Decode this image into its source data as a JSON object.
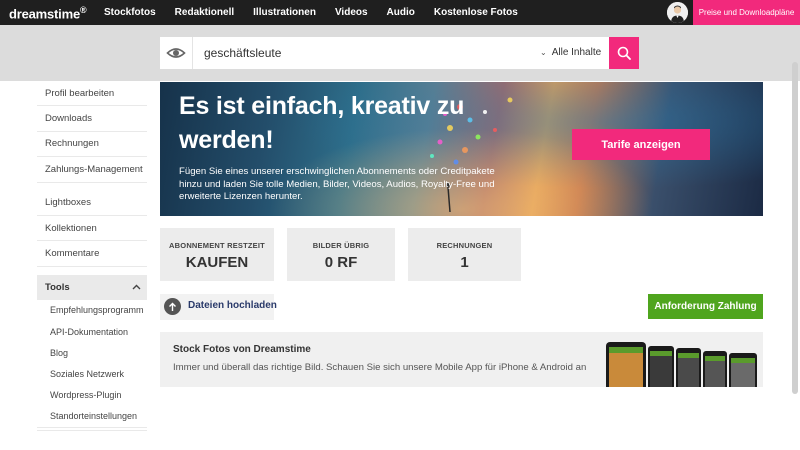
{
  "brand": {
    "logo_text": "dreamstime",
    "logo_mark": "®"
  },
  "nav": {
    "links": [
      "Stockfotos",
      "Redaktionell",
      "Illustrationen",
      "Videos",
      "Audio",
      "Kostenlose Fotos"
    ],
    "pricing_label": "Preise und Downloadpläne"
  },
  "search": {
    "value": "geschäftsleute",
    "filter_label": "Alle Inhalte",
    "filter_icon": "chevron-down-icon",
    "visibility_icon": "eye-icon",
    "button_icon": "search-icon"
  },
  "sidebar": {
    "items_top": [
      "Profil bearbeiten",
      "Downloads",
      "Rechnungen",
      "Zahlungs-Management"
    ],
    "items_mid": [
      "Lightboxes",
      "Kollektionen",
      "Kommentare"
    ],
    "tools": {
      "label": "Tools",
      "toggle_icon": "chevron-up-icon",
      "items": [
        "Empfehlungsprogramm",
        "API-Dokumentation",
        "Blog",
        "Soziales Netzwerk",
        "Wordpress-Plugin",
        "Standorteinstellungen"
      ]
    }
  },
  "banner": {
    "headline": "Es ist einfach, kreativ zu werden!",
    "body": "Fügen Sie eines unserer erschwinglichen Abonnements oder Creditpakete hinzu und laden Sie tolle Medien, Bilder, Videos, Audios, Royalty-Free und erweiterte Lizenzen herunter.",
    "cta_label": "Tarife anzeigen"
  },
  "stats": [
    {
      "label": "ABONNEMENT RESTZEIT",
      "value": "KAUFEN"
    },
    {
      "label": "BILDER ÜBRIG",
      "value": "0 RF"
    },
    {
      "label": "RECHNUNGEN",
      "value": "1"
    }
  ],
  "upload": {
    "label": "Dateien hochladen",
    "icon": "arrow-up-icon"
  },
  "payout": {
    "label": "Anforderung Zahlung"
  },
  "promo": {
    "title": "Stock Fotos von Dreamstime",
    "text": "Immer und überall das richtige Bild. Schauen Sie sich unsere Mobile App für iPhone & Android an"
  },
  "colors": {
    "accent": "#f2297c",
    "success": "#4fa51e",
    "nav_bg": "#1f1f1f"
  }
}
